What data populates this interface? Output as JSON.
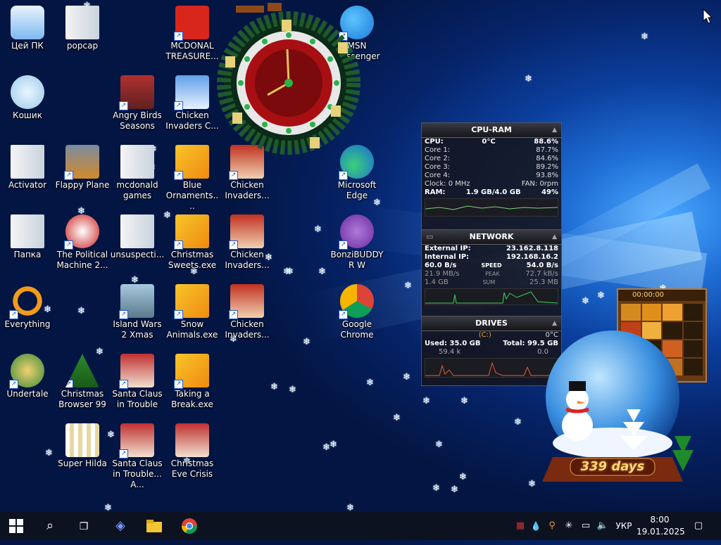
{
  "desktop_icons": [
    {
      "label": "Цей ПК",
      "col": 0,
      "row": 0,
      "icon": "computer-icon",
      "shortcut": false
    },
    {
      "label": "popcap",
      "col": 1,
      "row": 0,
      "icon": "folder-icon",
      "shortcut": false
    },
    {
      "label": "MCDONAL TREASURE...",
      "col": 3,
      "row": 0,
      "icon": "mcdonalds-icon",
      "shortcut": true
    },
    {
      "label": "MSN Messenger",
      "col": 6,
      "row": 0,
      "icon": "msn-icon",
      "shortcut": true
    },
    {
      "label": "Кошик",
      "col": 0,
      "row": 1,
      "icon": "recycle-bin-icon",
      "shortcut": false
    },
    {
      "label": "Angry Birds Seasons",
      "col": 2,
      "row": 1,
      "icon": "angry-birds-icon",
      "shortcut": true
    },
    {
      "label": "Chicken Invaders C...",
      "col": 3,
      "row": 1,
      "icon": "snowman-icon",
      "shortcut": true
    },
    {
      "label": "Activator",
      "col": 0,
      "row": 2,
      "icon": "folder-icon",
      "shortcut": false
    },
    {
      "label": "Flappy Plane",
      "col": 1,
      "row": 2,
      "icon": "flappy-plane-icon",
      "shortcut": true
    },
    {
      "label": "mcdonald games",
      "col": 2,
      "row": 2,
      "icon": "folder-icon",
      "shortcut": false
    },
    {
      "label": "Blue Ornaments....",
      "col": 3,
      "row": 2,
      "icon": "installer-icon",
      "shortcut": true
    },
    {
      "label": "Chicken Invaders...",
      "col": 4,
      "row": 2,
      "icon": "chicken-icon",
      "shortcut": true
    },
    {
      "label": "Microsoft Edge",
      "col": 6,
      "row": 2,
      "icon": "edge-icon",
      "shortcut": true
    },
    {
      "label": "Папка",
      "col": 0,
      "row": 3,
      "icon": "folder-icon",
      "shortcut": false
    },
    {
      "label": "The Political Machine 2...",
      "col": 1,
      "row": 3,
      "icon": "political-machine-icon",
      "shortcut": true
    },
    {
      "label": "unsuspecti...",
      "col": 2,
      "row": 3,
      "icon": "folder-icon",
      "shortcut": false
    },
    {
      "label": "Christmas Sweets.exe",
      "col": 3,
      "row": 3,
      "icon": "installer-icon",
      "shortcut": true
    },
    {
      "label": "Chicken Invaders...",
      "col": 4,
      "row": 3,
      "icon": "chicken-icon",
      "shortcut": true
    },
    {
      "label": "BonziBUDDYR W",
      "col": 6,
      "row": 3,
      "icon": "bonzi-icon",
      "shortcut": true
    },
    {
      "label": "Everything",
      "col": 0,
      "row": 4,
      "icon": "search-app-icon",
      "shortcut": true
    },
    {
      "label": "Island Wars 2 Xmas",
      "col": 2,
      "row": 4,
      "icon": "island-wars-icon",
      "shortcut": true
    },
    {
      "label": "Snow Animals.exe",
      "col": 3,
      "row": 4,
      "icon": "installer-icon",
      "shortcut": true
    },
    {
      "label": "Chicken Invaders...",
      "col": 4,
      "row": 4,
      "icon": "chicken-icon",
      "shortcut": true
    },
    {
      "label": "Google Chrome",
      "col": 6,
      "row": 4,
      "icon": "chrome-icon",
      "shortcut": true
    },
    {
      "label": "Undertale",
      "col": 0,
      "row": 5,
      "icon": "undertale-icon",
      "shortcut": true
    },
    {
      "label": "Christmas Browser 99",
      "col": 1,
      "row": 5,
      "icon": "christmas-tree-icon",
      "shortcut": true
    },
    {
      "label": "Santa Claus in Trouble",
      "col": 2,
      "row": 5,
      "icon": "santa-icon",
      "shortcut": true
    },
    {
      "label": "Taking a Break.exe",
      "col": 3,
      "row": 5,
      "icon": "installer-icon",
      "shortcut": true
    },
    {
      "label": "Super Hilda",
      "col": 1,
      "row": 6,
      "icon": "pixel-game-icon",
      "shortcut": false
    },
    {
      "label": "Santa Claus in Trouble... A...",
      "col": 2,
      "row": 6,
      "icon": "santa-icon",
      "shortcut": true
    },
    {
      "label": "Christmas Eve Crisis",
      "col": 3,
      "row": 6,
      "icon": "santa-icon",
      "shortcut": false
    }
  ],
  "cpu_ram": {
    "title": "CPU-RAM",
    "cpu_label": "CPU:",
    "cpu_temp": "0°C",
    "cpu_value": "88.6%",
    "cores": [
      {
        "label": "Core 1:",
        "value": "87.7%"
      },
      {
        "label": "Core 2:",
        "value": "84.6%"
      },
      {
        "label": "Core 3:",
        "value": "89.2%"
      },
      {
        "label": "Core 4:",
        "value": "93.8%"
      }
    ],
    "clock": "Clock: 0 MHz",
    "fan": "FAN: 0rpm",
    "ram_label": "RAM:",
    "ram_used": "1.9 GB/4.0 GB",
    "ram_value": "49%"
  },
  "network": {
    "title": "NETWORK",
    "external_label": "External IP:",
    "external_ip": "23.162.8.118",
    "internal_label": "Internal IP:",
    "internal_ip": "192.168.16.2",
    "speed_down": "60.0 B/s",
    "speed_label": "SPEED",
    "speed_up": "54.0 B/s",
    "peak_down": "21.9 MB/s",
    "peak_label": "PEAK",
    "peak_up": "72.7 kB/s",
    "sum_down": "1.4 GB",
    "sum_label": "SUM",
    "sum_up": "25.3 MB"
  },
  "drives": {
    "title": "DRIVES",
    "drive": "(C:)",
    "temp": "0°C",
    "used": "Used: 35.0 GB",
    "total": "Total: 99.5 GB",
    "read": "59.4 k",
    "write": "0.0"
  },
  "snow_globe": {
    "countdown": "339 days"
  },
  "puzzle_timer": {
    "time": "00:00:00"
  },
  "taskbar": {
    "apps": [
      "start-icon",
      "search-icon",
      "task-view-icon",
      "copilot-icon",
      "file-explorer-icon",
      "chrome-icon"
    ],
    "language": "УКР",
    "time": "8:00",
    "date": "19.01.2025"
  }
}
